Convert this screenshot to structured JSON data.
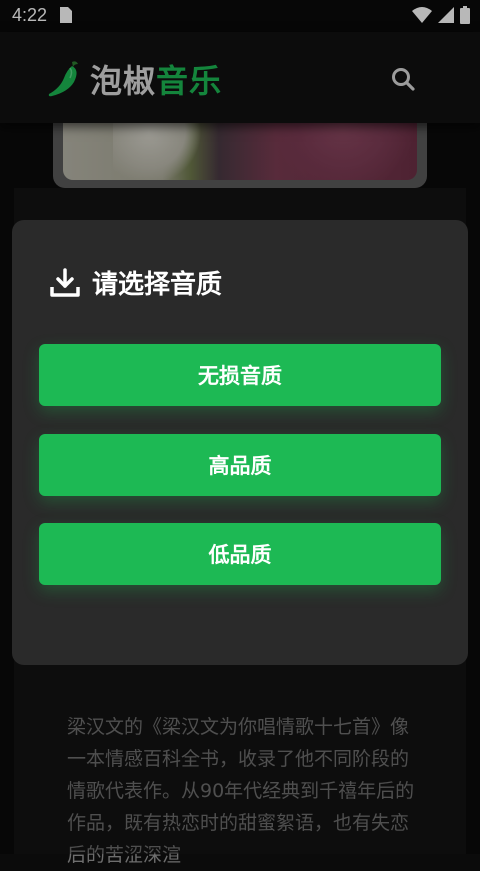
{
  "status_bar": {
    "time": "4:22"
  },
  "header": {
    "logo_part1": "泡椒",
    "logo_part2": "音乐",
    "logo_icon": "chili-pepper-icon",
    "search_icon": "search-icon"
  },
  "modal": {
    "title": "请选择音质",
    "title_icon": "download-icon",
    "buttons": [
      {
        "label": "无损音质"
      },
      {
        "label": "高品质"
      },
      {
        "label": "低品质"
      }
    ]
  },
  "background": {
    "description": "梁汉文的《梁汉文为你唱情歌十七首》像一本情感百科全书，收录了他不同阶段的情歌代表作。从90年代经典到千禧年后的作品，既有热恋时的甜蜜絮语，也有失恋后的苦涩深渲"
  },
  "colors": {
    "accent": "#1db954",
    "modal_bg": "#2a2a2a",
    "page_bg": "#0b0b0b"
  }
}
